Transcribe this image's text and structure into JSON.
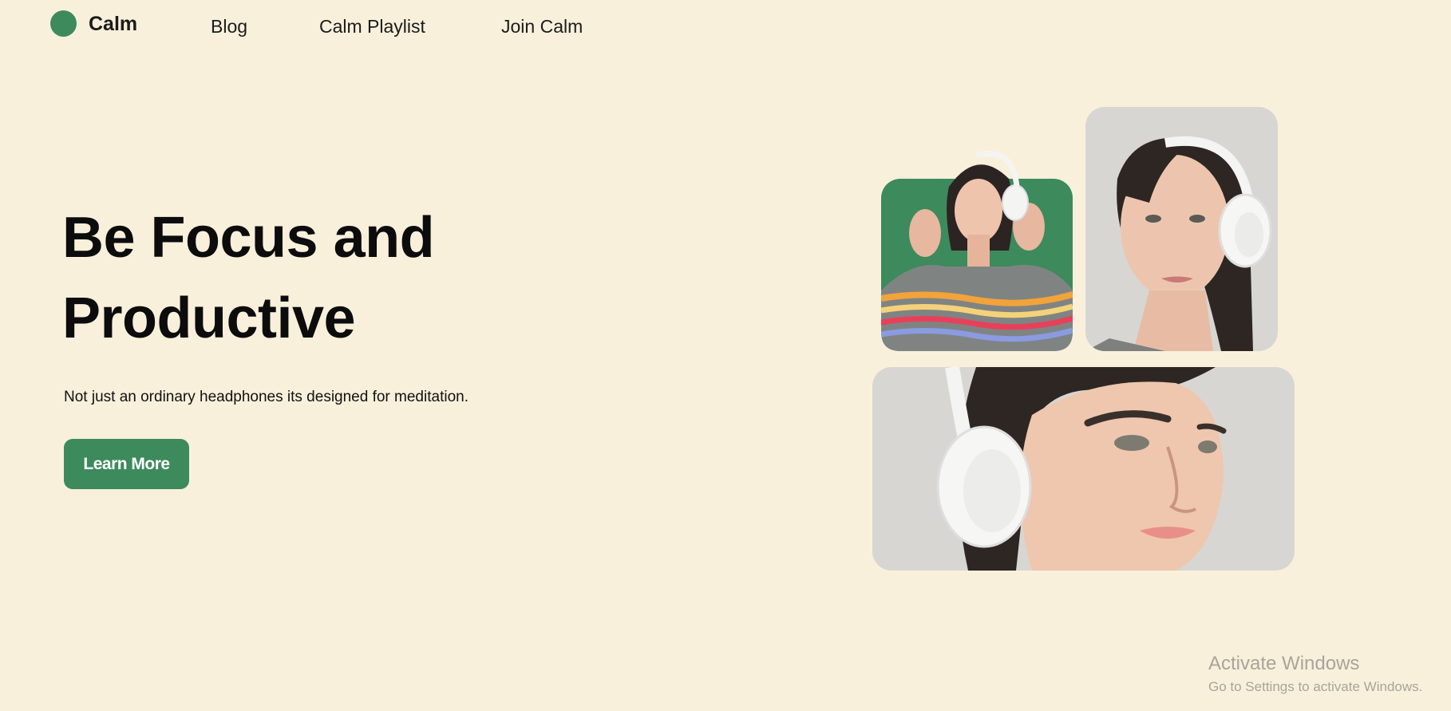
{
  "brand": {
    "name": "Calm",
    "accent_color": "#3d8a5c",
    "background_color": "#f9f0dc"
  },
  "nav": {
    "links": [
      {
        "label": "Blog"
      },
      {
        "label": "Calm Playlist"
      },
      {
        "label": "Join Calm"
      }
    ]
  },
  "hero": {
    "title": "Be Focus and Productive",
    "subtitle": "Not just an ordinary headphones its designed for meditation.",
    "cta_label": "Learn More"
  },
  "gallery": {
    "images": [
      {
        "name": "woman-headphones-green-bg",
        "background": "#3d8a5c"
      },
      {
        "name": "woman-headphones-portrait",
        "background": "#d7d6d2"
      },
      {
        "name": "woman-headphones-closeup",
        "background": "#d7d6d2"
      }
    ]
  },
  "watermark": {
    "title": "Activate Windows",
    "subtitle": "Go to Settings to activate Windows."
  }
}
